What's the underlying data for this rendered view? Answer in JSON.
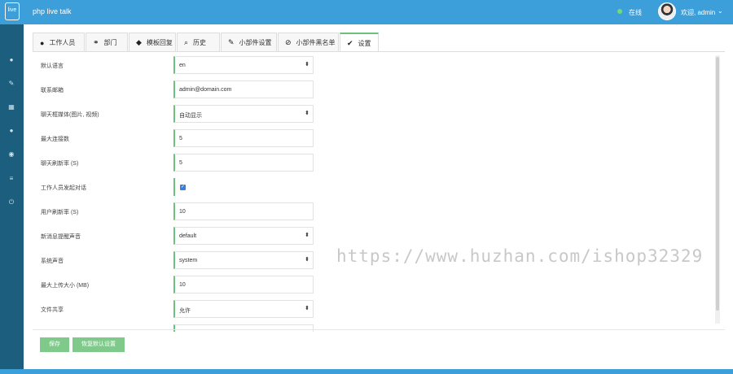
{
  "header": {
    "logo_text": "live",
    "app_title": "php live talk",
    "status": "在线",
    "welcome": "欢迎, admin",
    "colors": {
      "bar": "#3d9fd9",
      "status_dot": "#6fdc7a"
    }
  },
  "sidebar": {
    "items": [
      {
        "icon": "map-marker-icon",
        "glyph": "●"
      },
      {
        "icon": "pencil-icon",
        "glyph": "✎"
      },
      {
        "icon": "qrcode-icon",
        "glyph": "▦"
      },
      {
        "icon": "info-icon",
        "glyph": "●"
      },
      {
        "icon": "eye-icon",
        "glyph": "◉"
      },
      {
        "icon": "list-icon",
        "glyph": "≡"
      },
      {
        "icon": "power-icon",
        "glyph": "⏻"
      }
    ]
  },
  "tabs": [
    {
      "label": "工作人员",
      "icon": "user-icon",
      "glyph": "●"
    },
    {
      "label": "部门",
      "icon": "users-icon",
      "glyph": "⚭"
    },
    {
      "label": "模板回复",
      "icon": "comments-icon",
      "glyph": "◆"
    },
    {
      "label": "历史",
      "icon": "search-icon",
      "glyph": "⌕"
    },
    {
      "label": "小部件设置",
      "icon": "eyedropper-icon",
      "glyph": "✎"
    },
    {
      "label": "小部件黑名单",
      "icon": "ban-icon",
      "glyph": "⊘"
    },
    {
      "label": "设置",
      "icon": "wrench-icon",
      "glyph": "✔",
      "active": true
    }
  ],
  "settings": [
    {
      "label": "默认语言",
      "type": "select",
      "value": "en"
    },
    {
      "label": "联系邮箱",
      "type": "input",
      "value": "admin@domain.com"
    },
    {
      "label": "聊天框媒体(图片, 视频)",
      "type": "select",
      "value": "自动显示"
    },
    {
      "label": "最大连接数",
      "type": "input",
      "value": "5"
    },
    {
      "label": "聊天刷新率 (S)",
      "type": "input",
      "value": "5"
    },
    {
      "label": "工作人员发起对话",
      "type": "checkbox",
      "checked": true
    },
    {
      "label": "用户刷新率 (S)",
      "type": "input",
      "value": "10"
    },
    {
      "label": "新消息提醒声音",
      "type": "select",
      "value": "default"
    },
    {
      "label": "系统声音",
      "type": "select",
      "value": "system"
    },
    {
      "label": "最大上传大小 (MB)",
      "type": "input",
      "value": "10"
    },
    {
      "label": "文件共享",
      "type": "select",
      "value": "允许"
    }
  ],
  "buttons": {
    "save": "保存",
    "reset": "恢复默认设置"
  },
  "watermark": "https://www.huzhan.com/ishop32329",
  "accent": "#6ec07e"
}
